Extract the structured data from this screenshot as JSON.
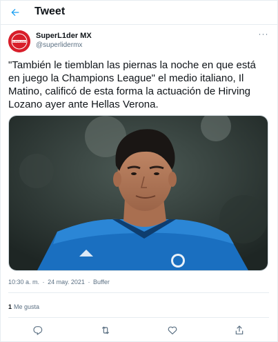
{
  "header": {
    "title": "Tweet",
    "back_icon": "arrow-left-icon",
    "accent": "#1da1f2"
  },
  "author": {
    "display_name": "SuperL1der MX",
    "handle": "@superlidermx",
    "avatar_text": "SUPERLIDER",
    "avatar_color": "#d81e2a"
  },
  "tweet": {
    "text": "\"También le tiemblan las piernas la noche en que está\nen juego la Champions League\" el medio italiano, Il\nMatino, calificó de esta forma la actuación de Hirving\nLozano ayer ante Hellas Verona.",
    "media_alt": "photo-of-player"
  },
  "meta": {
    "time": "10:30 a. m.",
    "separator1": "·",
    "date": "24 may. 2021",
    "separator2": "·",
    "source": "Buffer"
  },
  "engagement": {
    "likes_count": "1",
    "likes_label": "Me gusta"
  },
  "actions": [
    {
      "icon": "reply-icon"
    },
    {
      "icon": "retweet-icon"
    },
    {
      "icon": "like-icon"
    },
    {
      "icon": "share-icon"
    }
  ]
}
